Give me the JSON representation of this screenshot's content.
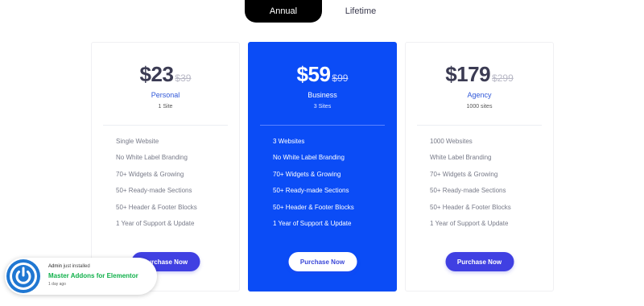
{
  "billing_toggle": {
    "annual_label": "Annual",
    "lifetime_label": "Lifetime",
    "selected": "Annual"
  },
  "plans": [
    {
      "price": "$23",
      "old_price": "$39",
      "name": "Personal",
      "sites": "1 Site",
      "features": [
        "Single Website",
        "No White Label Branding",
        "70+ Widgets & Growing",
        "50+ Ready-made Sections",
        "50+ Header & Footer Blocks",
        "1 Year of Support & Update"
      ],
      "button": "Purchase Now"
    },
    {
      "price": "$59",
      "old_price": "$99",
      "name": "Business",
      "sites": "3 Sites",
      "features": [
        "3 Websites",
        "No White Label Branding",
        "70+ Widgets & Growing",
        "50+ Ready-made Sections",
        "50+ Header & Footer Blocks",
        "1 Year of Support & Update"
      ],
      "button": "Purchase Now"
    },
    {
      "price": "$179",
      "old_price": "$299",
      "name": "Agency",
      "sites": "1000 sites",
      "features": [
        "1000 Websites",
        "White Label Branding",
        "70+ Widgets & Growing",
        "50+ Ready-made Sections",
        "50+ Header & Footer Blocks",
        "1 Year of Support & Update"
      ],
      "button": "Purchase Now"
    }
  ],
  "notification": {
    "user": "Admin",
    "action": "just installed",
    "product": "Master Addons for Elementor",
    "time": "1 day ago",
    "icon": "power-logo-icon"
  },
  "colors": {
    "featured_bg": "#0b4cf6",
    "button_bg": "#4040e2",
    "toggle_active": "#000000",
    "notification_product": "#10b04a"
  }
}
